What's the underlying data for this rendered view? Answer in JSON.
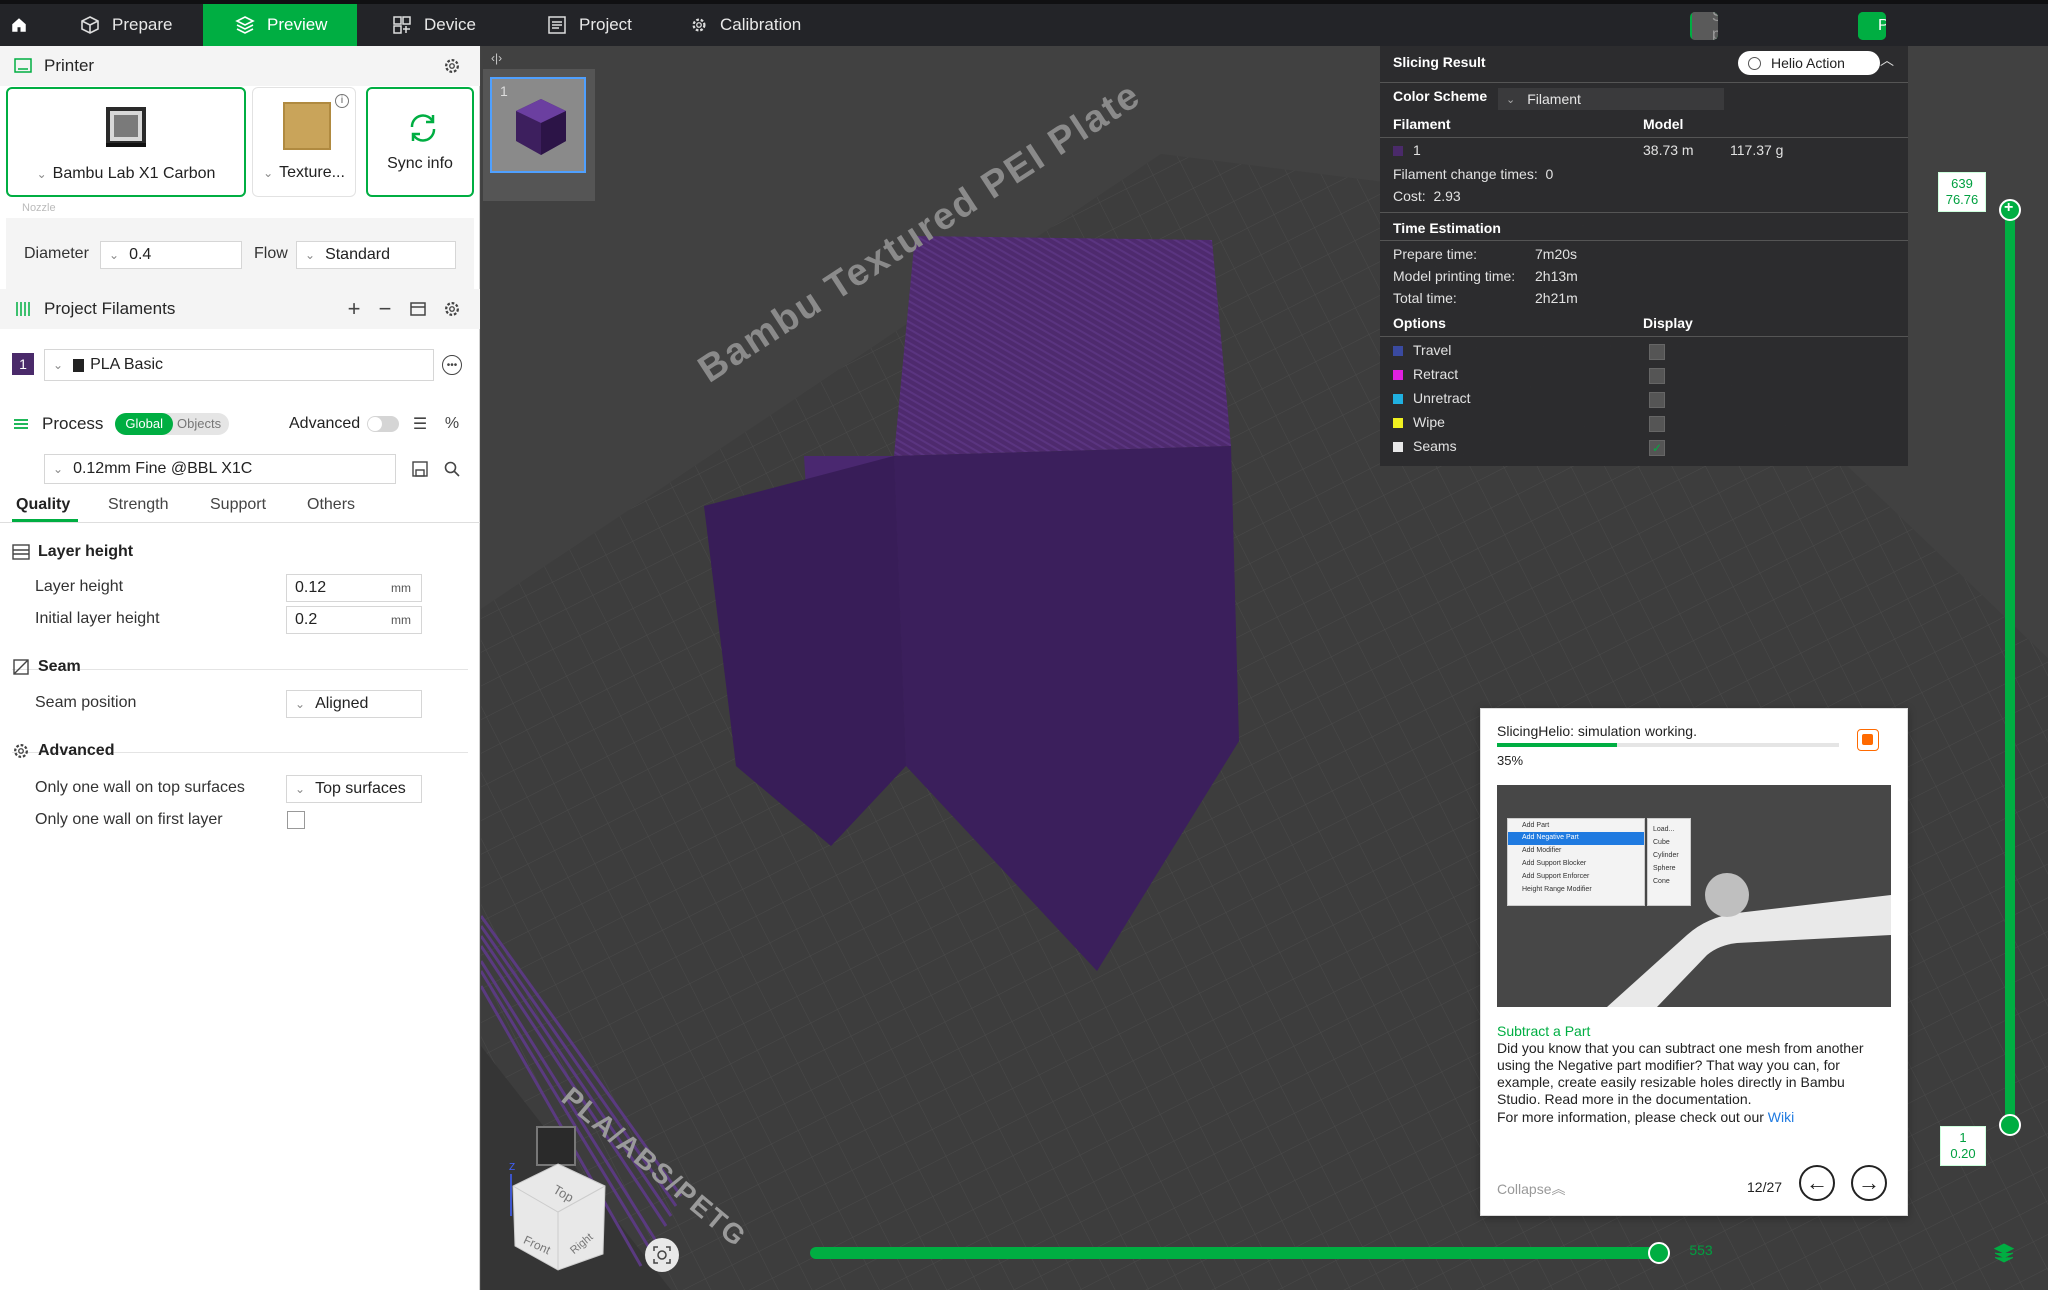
{
  "topbar": {
    "tabs": [
      {
        "label": "Prepare",
        "icon": "cube-icon"
      },
      {
        "label": "Preview",
        "icon": "layers-icon"
      },
      {
        "label": "Device",
        "icon": "device-icon"
      },
      {
        "label": "Project",
        "icon": "project-icon"
      },
      {
        "label": "Calibration",
        "icon": "gear-icon"
      }
    ],
    "slice_label": "Slice plate",
    "print_label": "Print plate",
    "accent": "#00ae42"
  },
  "printer": {
    "section_title": "Printer",
    "printer_name": "Bambu Lab X1 Carbon",
    "plate_name": "Texture...",
    "sync_label": "Sync info",
    "nozzle_label": "Nozzle",
    "diameter_label": "Diameter",
    "diameter_value": "0.4",
    "flow_label": "Flow",
    "flow_value": "Standard"
  },
  "filaments": {
    "section_title": "Project Filaments",
    "items": [
      {
        "index": "1",
        "name": "PLA Basic",
        "color": "#4a2a6a"
      }
    ]
  },
  "process": {
    "section_title": "Process",
    "toggle_global": "Global",
    "toggle_objects": "Objects",
    "advanced_label": "Advanced",
    "profile": "0.12mm Fine @BBL X1C",
    "tabs": [
      "Quality",
      "Strength",
      "Support",
      "Others"
    ],
    "layer_height": {
      "title": "Layer height",
      "layer_height_label": "Layer height",
      "layer_height_value": "0.12",
      "initial_label": "Initial layer height",
      "initial_value": "0.2",
      "unit": "mm"
    },
    "seam": {
      "title": "Seam",
      "position_label": "Seam position",
      "position_value": "Aligned"
    },
    "advanced": {
      "title": "Advanced",
      "top_label": "Only one wall on top surfaces",
      "top_value": "Top surfaces",
      "first_label": "Only one wall on first layer"
    }
  },
  "plate": {
    "thumb_index": "1",
    "bed_label": "Bambu Textured PEI Plate",
    "material_label": "PLA/ABS/PETG",
    "nav_cube": {
      "top": "Top",
      "front": "Front",
      "right": "Right",
      "z": "Z"
    }
  },
  "result": {
    "title": "Slicing Result",
    "helio_label": "Helio Action",
    "color_scheme_label": "Color Scheme",
    "color_scheme_value": "Filament",
    "col_filament": "Filament",
    "col_model": "Model",
    "filament_index": "1",
    "model_length": "38.73 m",
    "model_weight": "117.37 g",
    "change_times_label": "Filament change times:",
    "change_times_value": "0",
    "cost_label": "Cost:",
    "cost_value": "2.93",
    "time_title": "Time Estimation",
    "prepare_label": "Prepare time:",
    "prepare_value": "7m20s",
    "model_print_label": "Model printing time:",
    "model_print_value": "2h13m",
    "total_label": "Total time:",
    "total_value": "2h21m",
    "options_label": "Options",
    "display_label": "Display",
    "options": [
      {
        "label": "Travel",
        "color": "#3a4aa0"
      },
      {
        "label": "Retract",
        "color": "#e020e0"
      },
      {
        "label": "Unretract",
        "color": "#20b0e0"
      },
      {
        "label": "Wipe",
        "color": "#f0f020"
      },
      {
        "label": "Seams",
        "color": "#e8e8e8"
      }
    ]
  },
  "notification": {
    "status": "SlicingHelio: simulation working.",
    "percent": "35%",
    "progress": 0.35,
    "tip_title": "Subtract a Part",
    "tip_body": "Did you know that you can subtract one mesh from another using the Negative part modifier? That way you can, for example, create easily resizable holes directly in Bambu Studio. Read more in the documentation.",
    "more_prefix": "For more information, please check out our",
    "wiki_label": "Wiki",
    "collapse_label": "Collapse",
    "page": "12/27",
    "menu": {
      "items": [
        "Add Part",
        "Add Negative Part",
        "Add Modifier",
        "Add Support Blocker",
        "Add Support Enforcer",
        "Height Range Modifier"
      ],
      "sub": [
        "Load...",
        "Cube",
        "Cylinder",
        "Sphere",
        "Cone"
      ]
    }
  },
  "slider": {
    "top_layer": "639",
    "top_height": "76.76",
    "bottom_layer": "1",
    "bottom_height": "0.20",
    "horizontal_value": "553"
  }
}
